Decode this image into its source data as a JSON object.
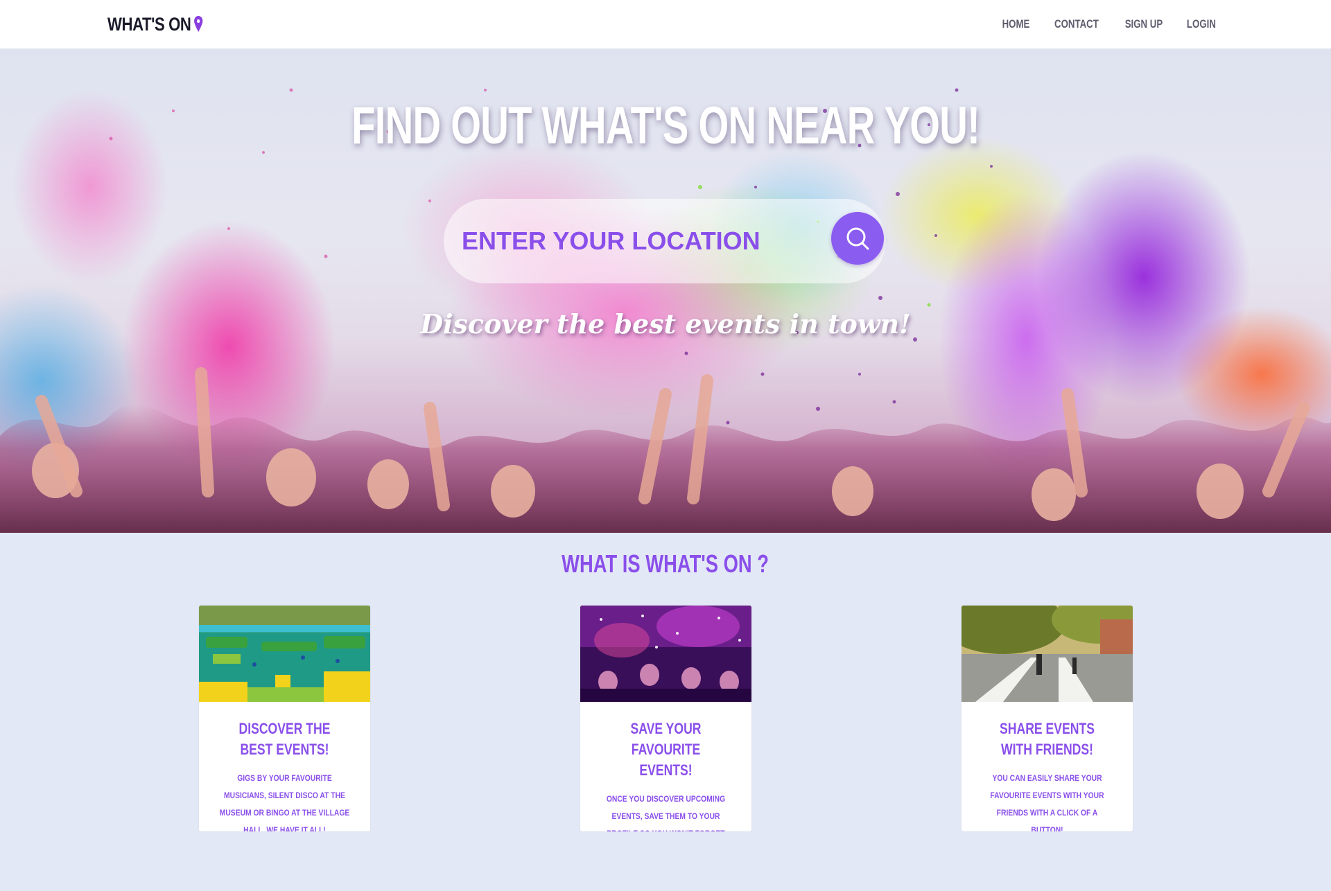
{
  "nav": {
    "logo": "WHAT'S ON",
    "links": [
      "HOME",
      "CONTACT",
      "SIGN UP",
      "LOGIN"
    ]
  },
  "hero": {
    "title": "FIND OUT WHAT'S ON NEAR YOU!",
    "search_placeholder": "ENTER YOUR LOCATION",
    "tagline": "Discover the best events in town!"
  },
  "about": {
    "title": "WHAT IS WHAT'S ON ?",
    "cards": [
      {
        "title": "DISCOVER THE BEST EVENTS!",
        "text": "GIGS BY YOUR FAVOURITE MUSICIANS, SILENT DISCO AT THE MUSEUM OR BINGO AT THE VILLAGE HALL, WE HAVE IT ALL!"
      },
      {
        "title": "SAVE YOUR FAVOURITE EVENTS!",
        "text": "ONCE YOU DISCOVER UPCOMING EVENTS, SAVE THEM TO YOUR PROFILE SO YOU WON'T FORGET THEM!"
      },
      {
        "title": "SHARE EVENTS WITH FRIENDS!",
        "text": "YOU CAN EASILY SHARE YOUR FAVOURITE EVENTS WITH YOUR FRIENDS WITH A CLICK OF A BUTTON!"
      }
    ]
  },
  "colors": {
    "accent": "#8a4fea",
    "search_button": "#8b5cf0",
    "section_bg": "#e3e8f6"
  },
  "icons": {
    "logo_pin": "map-pin-icon",
    "search": "search-icon"
  }
}
